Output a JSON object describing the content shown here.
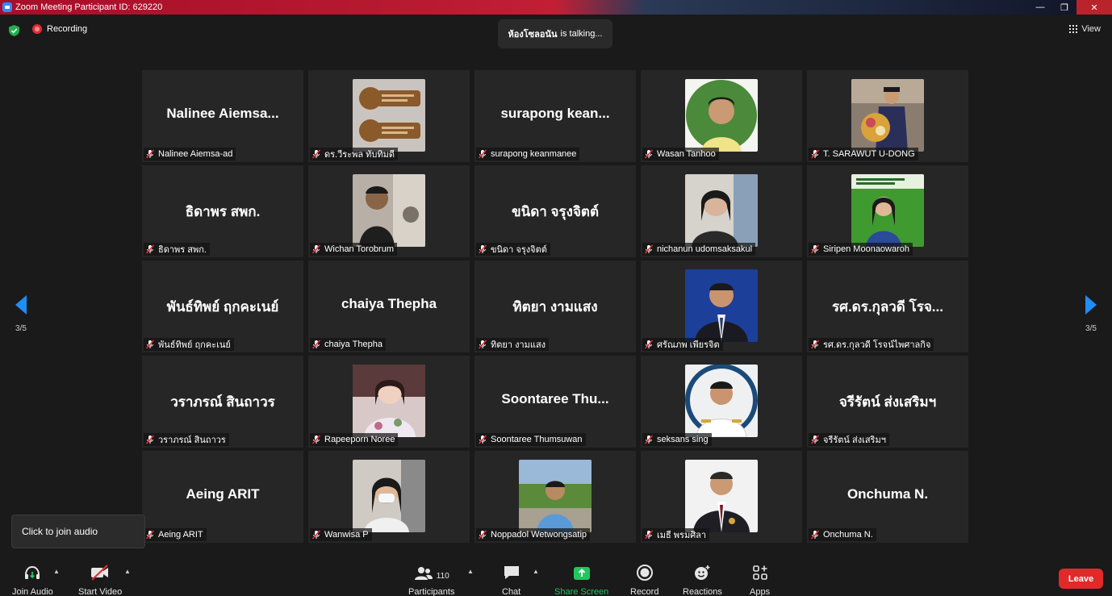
{
  "window": {
    "title": "Zoom Meeting Participant ID: 629220",
    "controls": [
      "minimize",
      "restore",
      "close"
    ]
  },
  "topbar": {
    "recording_label": "Recording",
    "talking_name": "ห้องโซลอนัน",
    "talking_suffix": "is talking...",
    "view_label": "View"
  },
  "pagination": {
    "left": "3/5",
    "right": "3/5"
  },
  "participants": [
    {
      "display": "Nalinee  Aiemsa...",
      "name": "Nalinee Aiemsa-ad",
      "video": false
    },
    {
      "display": "",
      "name": "ดร.วีระพล  ทับทิมดี",
      "video": true,
      "photo": "logo-badges"
    },
    {
      "display": "surapong  kean...",
      "name": "surapong keanmanee",
      "video": false
    },
    {
      "display": "",
      "name": "Wasan Tanhoo",
      "video": true,
      "photo": "portrait-green"
    },
    {
      "display": "",
      "name": "T. SARAWUT U-DONG",
      "video": true,
      "photo": "graduation"
    },
    {
      "display": "ธิดาพร สพก.",
      "name": "ธิดาพร สพก.",
      "video": false
    },
    {
      "display": "",
      "name": "Wichan Torobrum",
      "video": true,
      "photo": "portrait-temple"
    },
    {
      "display": "ขนิดา จรุงจิตต์",
      "name": "ขนิดา จรุงจิตต์",
      "video": false
    },
    {
      "display": "",
      "name": "nichanun udomsaksakul",
      "video": true,
      "photo": "portrait-reading"
    },
    {
      "display": "",
      "name": "Siripen  Moonaowaroh",
      "video": true,
      "photo": "portrait-poster"
    },
    {
      "display": "พันธ์ทิพย์  ฤกคะเนย์",
      "name": "พันธ์ทิพย์  ฤกคะเนย์",
      "video": false
    },
    {
      "display": "chaiya Thepha",
      "name": "chaiya Thepha",
      "video": false
    },
    {
      "display": "ทิตยา งามแสง",
      "name": "ทิตยา งามแสง",
      "video": false
    },
    {
      "display": "",
      "name": "ศรัณภพ เพียรจิต",
      "video": true,
      "photo": "portrait-suit-blue"
    },
    {
      "display": "รศ.ดร.กุลวดี โรจ...",
      "name": "รศ.ดร.กุลวดี โรจน์ไพศาลกิจ",
      "video": false
    },
    {
      "display": "วราภรณ์ สินถาวร",
      "name": "วราภรณ์ สินถาวร",
      "video": false
    },
    {
      "display": "",
      "name": "Rapeeporn Noree",
      "video": true,
      "photo": "portrait-floral"
    },
    {
      "display": "Soontaree  Thu...",
      "name": "Soontaree Thumsuwan",
      "video": false
    },
    {
      "display": "",
      "name": "seksans sing",
      "video": true,
      "photo": "portrait-uniform"
    },
    {
      "display": "จรีรัตน์ ส่งเสริมฯ",
      "name": "จรีรัตน์ ส่งเสริมฯ",
      "video": false
    },
    {
      "display": "Aeing ARIT",
      "name": "Aeing ARIT",
      "video": false
    },
    {
      "display": "",
      "name": "Wanwisa P",
      "video": true,
      "photo": "portrait-mask"
    },
    {
      "display": "",
      "name": "Noppadol Wetwongsatip",
      "video": true,
      "photo": "portrait-outdoor"
    },
    {
      "display": "",
      "name": "เมธี พรมศิลา",
      "video": true,
      "photo": "portrait-suit-white"
    },
    {
      "display": "Onchuma N.",
      "name": "Onchuma N.",
      "video": false
    }
  ],
  "tooltip": {
    "text": "Click to join audio"
  },
  "toolbar": {
    "join_audio": "Join Audio",
    "start_video": "Start Video",
    "participants": "Participants",
    "participants_count": "110",
    "chat": "Chat",
    "share_screen": "Share Screen",
    "record": "Record",
    "reactions": "Reactions",
    "apps": "Apps",
    "leave": "Leave"
  },
  "colors": {
    "accent_blue": "#1f8df5",
    "share_green": "#22c55e",
    "leave_red": "#e02a2a",
    "recording_red": "#e02d36",
    "tile_bg": "#262626",
    "app_bg": "#1a1a1a"
  }
}
